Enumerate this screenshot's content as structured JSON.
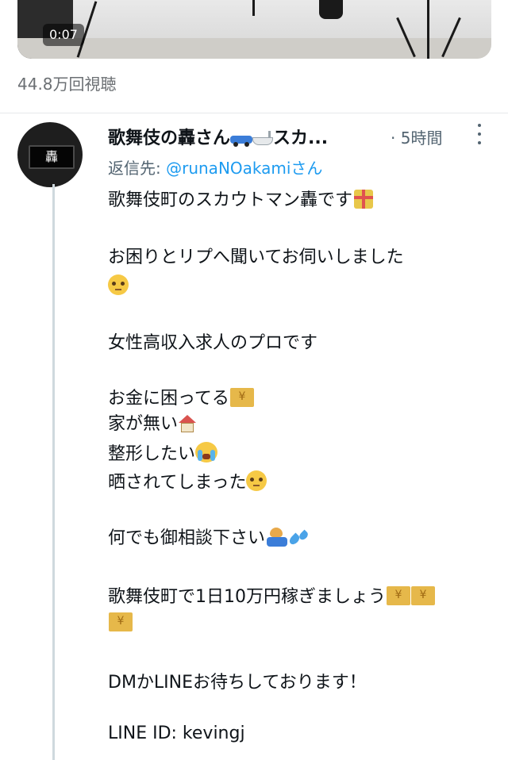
{
  "video": {
    "timestamp": "0:07"
  },
  "views": "44.8万回視聴",
  "reply": {
    "author_name": "歌舞伎の轟さん",
    "author_name_suffix": "スカ...",
    "time_separator": "·",
    "time_ago": "5時間",
    "reply_to_label": "返信先:",
    "reply_to_handle": "@runaNOakamiさん",
    "avatar_text": "轟",
    "lines": [
      "歌舞伎町のスカウトマン轟です",
      "お困りとリプへ聞いてお伺いしました",
      "女性高収入求人のプロです",
      "お金に困ってる",
      "家が無い",
      "整形したい",
      "晒されてしまった",
      "何でも御相談下さい",
      "歌舞伎町で1日10万円稼ぎましょう",
      "DMかLINEお待ちしております！",
      "LINE ID:  kevingj"
    ]
  },
  "icons": [
    "car-icon",
    "bathtub-icon",
    "gift-icon",
    "relieved-face-icon",
    "money-icon",
    "house-icon",
    "crying-face-icon",
    "bowing-person-icon",
    "sweat-droplets-icon",
    "more-icon"
  ],
  "colors": {
    "link": "#1d9bf0",
    "secondary_text": "#536471",
    "thread_line": "#cfd9de"
  }
}
